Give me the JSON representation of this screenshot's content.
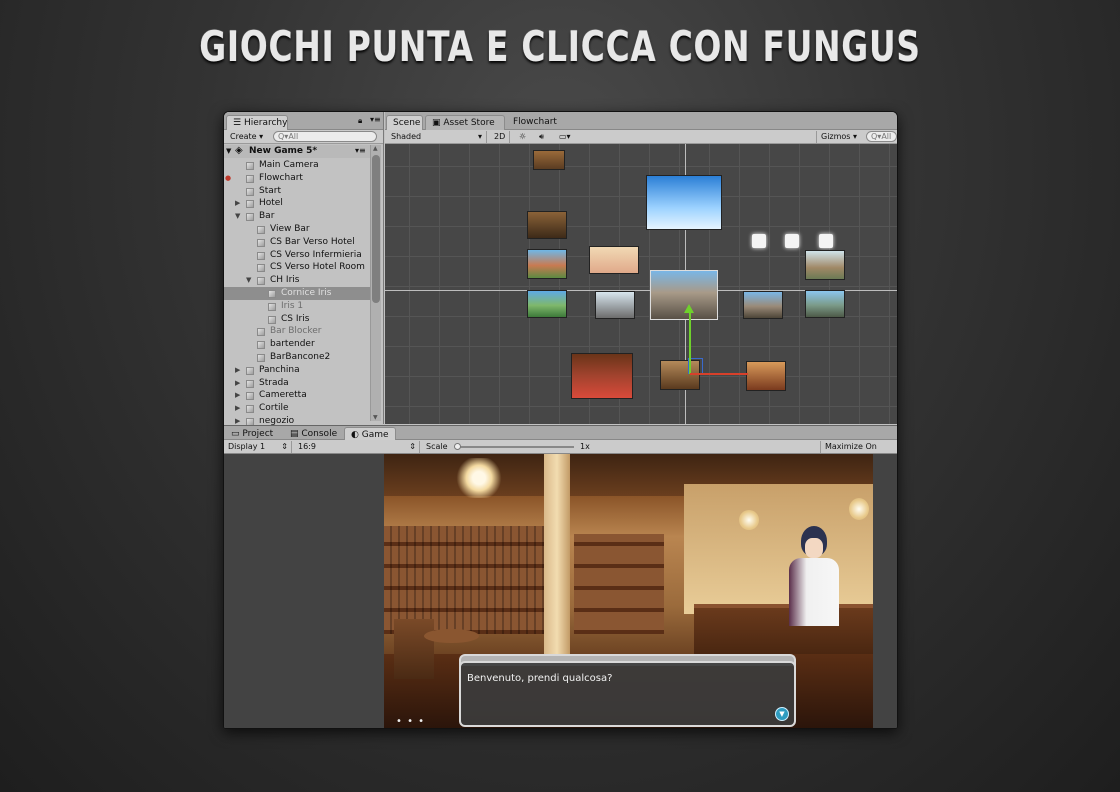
{
  "banner": {
    "title": "GIOCHI PUNTA E CLICCA CON FUNGUS"
  },
  "hierarchy": {
    "tab_label": "Hierarchy",
    "create_label": "Create",
    "search_placeholder": "Q▾All",
    "scene_name": "New Game 5*",
    "items": [
      {
        "label": "Main Camera"
      },
      {
        "label": "Flowchart"
      },
      {
        "label": "Start"
      },
      {
        "label": "Hotel"
      },
      {
        "label": "Bar"
      },
      {
        "label": "View Bar"
      },
      {
        "label": "CS Bar Verso Hotel"
      },
      {
        "label": "CS Verso Infermieria"
      },
      {
        "label": "CS Verso Hotel Room"
      },
      {
        "label": "CH Iris"
      },
      {
        "label": "Cornice Iris"
      },
      {
        "label": "Iris 1"
      },
      {
        "label": "CS Iris"
      },
      {
        "label": "Bar Blocker"
      },
      {
        "label": "bartender"
      },
      {
        "label": "BarBancone2"
      },
      {
        "label": "Panchina"
      },
      {
        "label": "Strada"
      },
      {
        "label": "Cameretta"
      },
      {
        "label": "Cortile"
      },
      {
        "label": "negozio"
      }
    ]
  },
  "scene": {
    "tabs": [
      {
        "label": "Scene"
      },
      {
        "label": "Asset Store"
      },
      {
        "label": "Flowchart"
      }
    ],
    "shading": "Shaded",
    "mode_2d": "2D",
    "gizmos": "Gizmos",
    "search_placeholder": "Q▾All"
  },
  "bottom": {
    "tabs": [
      {
        "label": "Project"
      },
      {
        "label": "Console"
      },
      {
        "label": "Game"
      }
    ],
    "display": "Display 1",
    "aspect": "16:9",
    "scale_label": "Scale",
    "scale_value": "1x",
    "maximize": "Maximize On Play"
  },
  "game": {
    "dialog_text": "Benvenuto, prendi qualcosa?",
    "dots": "• • •"
  },
  "colors": {
    "accent_blue": "#2f9cc0",
    "editor_bg": "#c2c2c2",
    "scene_bg": "#474747"
  }
}
